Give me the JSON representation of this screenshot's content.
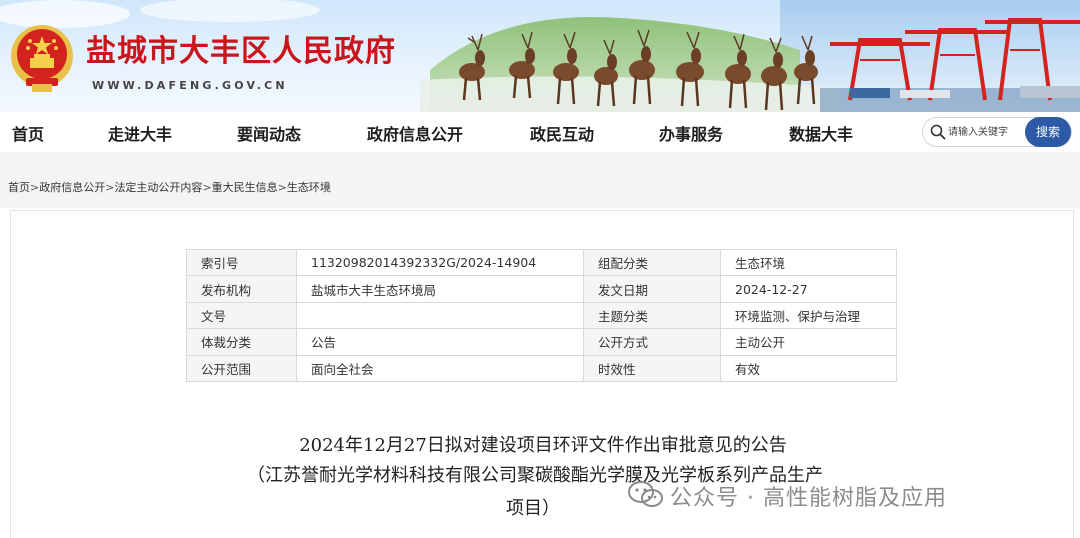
{
  "header": {
    "site_title": "盐城市大丰区人民政府",
    "site_domain": "WWW.DAFENG.GOV.CN",
    "emblem_icon": "national-emblem",
    "brand_color": "#c8161d"
  },
  "nav": {
    "items": [
      {
        "label": "首页"
      },
      {
        "label": "走进大丰"
      },
      {
        "label": "要闻动态"
      },
      {
        "label": "政府信息公开"
      },
      {
        "label": "政民互动"
      },
      {
        "label": "办事服务"
      },
      {
        "label": "数据大丰"
      }
    ],
    "search": {
      "placeholder": "请输入关键字",
      "value": "",
      "button_label": "搜索",
      "icon": "search-icon",
      "button_color": "#2d5aa6"
    }
  },
  "breadcrumb": {
    "items": [
      "首页",
      "政府信息公开",
      "法定主动公开内容",
      "重大民生信息",
      "生态环境"
    ],
    "separator": ">"
  },
  "meta": {
    "rows": [
      {
        "k1": "索引号",
        "v1": "11320982014392332G/2024-14904",
        "k2": "组配分类",
        "v2": "生态环境"
      },
      {
        "k1": "发布机构",
        "v1": "盐城市大丰生态环境局",
        "k2": "发文日期",
        "v2": "2024-12-27"
      },
      {
        "k1": "文号",
        "v1": "",
        "k2": "主题分类",
        "v2": "环境监测、保护与治理"
      },
      {
        "k1": "体裁分类",
        "v1": "公告",
        "k2": "公开方式",
        "v2": "主动公开"
      },
      {
        "k1": "公开范围",
        "v1": "面向全社会",
        "k2": "时效性",
        "v2": "有效"
      }
    ]
  },
  "document": {
    "title_line1": "2024年12月27日拟对建设项目环评文件作出审批意见的公告",
    "title_line2": "（江苏誉耐光学材料科技有限公司聚碳酸酯光学膜及光学板系列产品生产",
    "title_line3": "项目）"
  },
  "watermark": {
    "text": "公众号 · 高性能树脂及应用",
    "icon": "wechat-icon"
  }
}
